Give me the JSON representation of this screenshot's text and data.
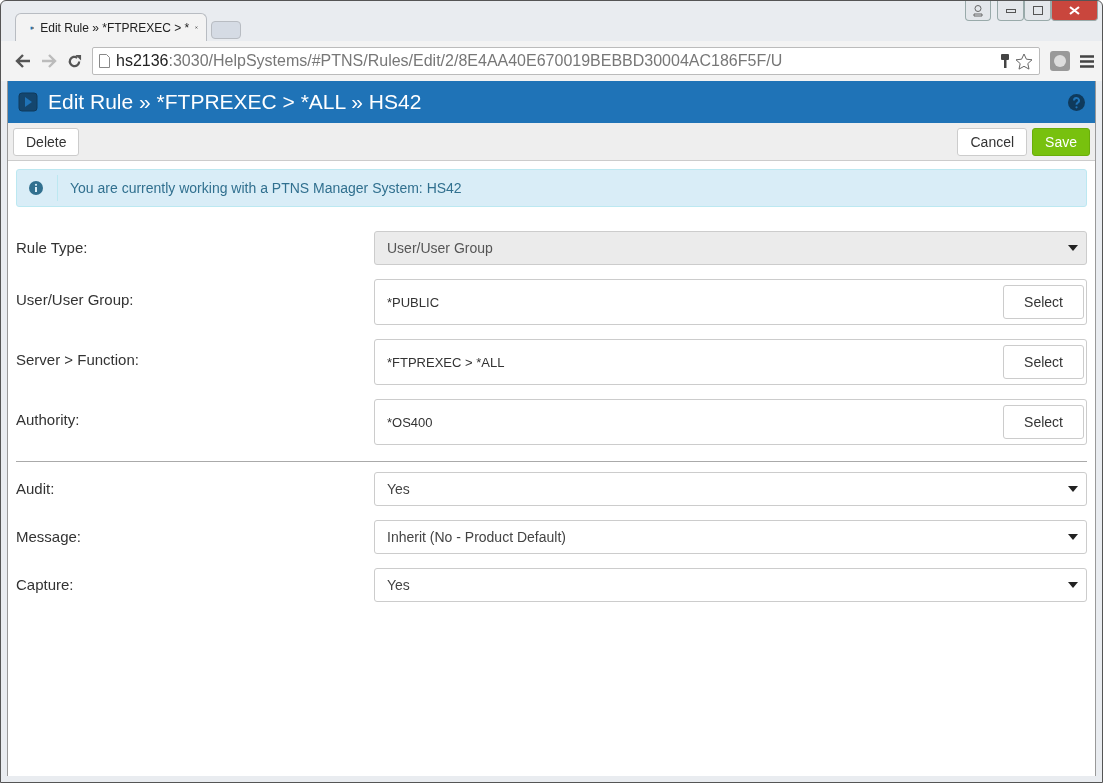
{
  "browser": {
    "tab_title": "Edit Rule » *FTPREXEC > *",
    "url_host": "hs2136",
    "url_rest": ":3030/HelpSystems/#PTNS/Rules/Edit/2/8E4AA40E670019BEBBD30004AC186F5F/U"
  },
  "header": {
    "title": "Edit Rule » *FTPREXEC > *ALL » HS42"
  },
  "toolbar": {
    "left": [
      "Delete"
    ],
    "right": [
      {
        "label": "Cancel",
        "kind": "default"
      },
      {
        "label": "Save",
        "kind": "primary"
      }
    ]
  },
  "alert": {
    "text": "You are currently working with a PTNS Manager System: HS42"
  },
  "groups": [
    {
      "fields": [
        {
          "label": "Rule Type:",
          "kind": "select",
          "value": "User/User Group",
          "disabled": true
        },
        {
          "label": "User/User Group:",
          "kind": "picker",
          "value": "*PUBLIC",
          "button": "Select"
        },
        {
          "label": "Server > Function:",
          "kind": "picker",
          "value": "*FTPREXEC > *ALL",
          "button": "Select"
        },
        {
          "label": "Authority:",
          "kind": "picker",
          "value": "*OS400",
          "button": "Select"
        }
      ]
    },
    {
      "fields": [
        {
          "label": "Audit:",
          "kind": "select",
          "value": "Yes",
          "disabled": false
        },
        {
          "label": "Message:",
          "kind": "select",
          "value": "Inherit (No - Product Default)",
          "disabled": false
        },
        {
          "label": "Capture:",
          "kind": "select",
          "value": "Yes",
          "disabled": false
        }
      ]
    }
  ]
}
